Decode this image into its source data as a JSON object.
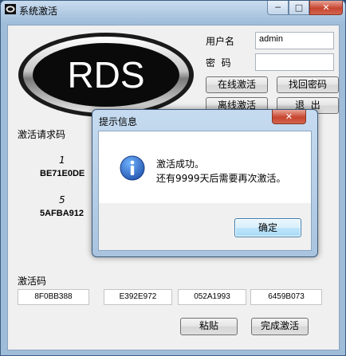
{
  "window": {
    "title": "系统激活",
    "min_glyph": "─",
    "max_glyph": "□",
    "close_glyph": "✕"
  },
  "logo": {
    "text": "RDS"
  },
  "login": {
    "username_label": "用户名",
    "username_value": "admin",
    "password_label": "密  码",
    "password_value": ""
  },
  "buttons": {
    "online": "在线激活",
    "recover": "找回密码",
    "offline": "离线激活",
    "exit": "退  出",
    "paste": "粘贴",
    "finish": "完成激活"
  },
  "request": {
    "label": "激活请求码",
    "items": [
      {
        "num": "1",
        "code": "BE71E0DE"
      },
      {
        "num": "5",
        "code": "5AFBA912"
      }
    ]
  },
  "activation": {
    "label": "激活码",
    "codes": [
      "8F0BB388",
      "E392E972",
      "052A1993",
      "6459B073"
    ]
  },
  "dialog": {
    "title": "提示信息",
    "line1": "激活成功。",
    "line2": "还有9999天后需要再次激活。",
    "ok": "确定",
    "close_glyph": "✕"
  },
  "colors": {
    "titlebar": "#b9d1ea",
    "close_red": "#c7452f",
    "info_blue": "#1f62c4"
  }
}
